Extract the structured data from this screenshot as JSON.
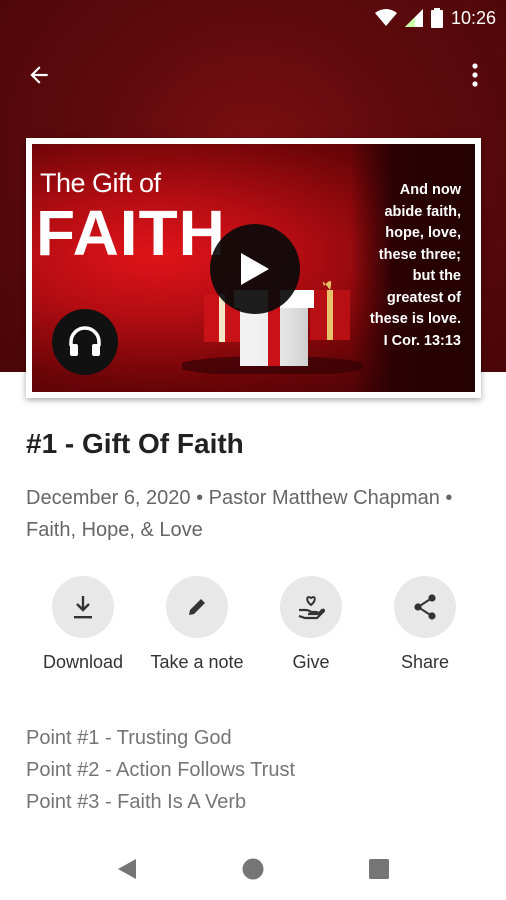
{
  "status_bar": {
    "time": "10:26"
  },
  "app_bar": {
    "back_icon": "arrow-back-icon",
    "more_icon": "more-vert-icon"
  },
  "artwork": {
    "title_small": "The Gift of",
    "title_big": "FAITH",
    "quote_lines": [
      "And now",
      "abide faith,",
      "hope, love,",
      "these three;",
      "but the",
      "greatest of",
      "these is love.",
      "I Cor. 13:13"
    ]
  },
  "sermon": {
    "title": "#1 - Gift Of Faith",
    "meta": "December 6, 2020 • Pastor Matthew Chapman • Faith, Hope, & Love"
  },
  "actions": [
    {
      "label": "Download",
      "icon": "download-icon"
    },
    {
      "label": "Take a note",
      "icon": "pencil-icon"
    },
    {
      "label": "Give",
      "icon": "give-hand-heart-icon"
    },
    {
      "label": "Share",
      "icon": "share-icon"
    }
  ],
  "points": [
    "Point #1 - Trusting God",
    "Point #2 - Action Follows Trust",
    "Point #3 - Faith Is A Verb"
  ],
  "colors": {
    "header": "#5e0a0c",
    "accent": "#d0141a"
  }
}
